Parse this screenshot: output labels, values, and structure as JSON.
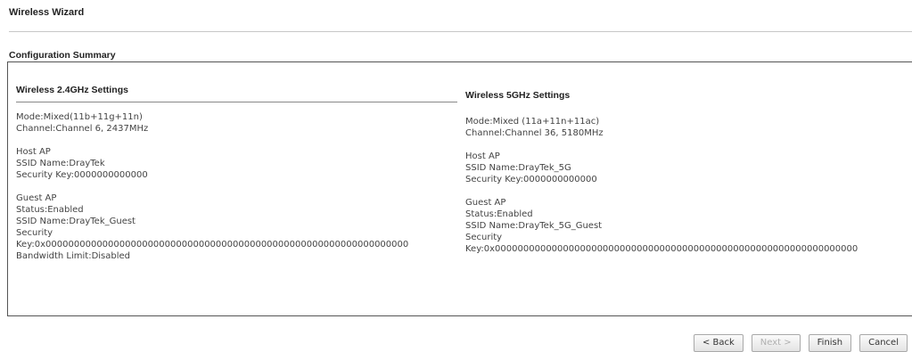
{
  "page": {
    "title": "Wireless Wizard"
  },
  "summary": {
    "title": "Configuration Summary"
  },
  "wireless_24": {
    "title": "Wireless 2.4GHz Settings",
    "mode": "Mode:Mixed(11b+11g+11n)",
    "channel": "Channel:Channel 6, 2437MHz",
    "host_ap": {
      "label": "Host AP",
      "ssid": "SSID Name:DrayTek",
      "security_key": "Security Key:0000000000000"
    },
    "guest_ap": {
      "label": "Guest AP",
      "status": "Status:Enabled",
      "ssid": "SSID Name:DrayTek_Guest",
      "security_label": "Security",
      "security_key": "Key:0x0000000000000000000000000000000000000000000000000000000000000000",
      "bandwidth": "Bandwidth Limit:Disabled"
    }
  },
  "wireless_5g": {
    "title": "Wireless 5GHz Settings",
    "mode": "Mode:Mixed (11a+11n+11ac)",
    "channel": "Channel:Channel 36, 5180MHz",
    "host_ap": {
      "label": "Host AP",
      "ssid": "SSID Name:DrayTek_5G",
      "security_key": "Security Key:0000000000000"
    },
    "guest_ap": {
      "label": "Guest AP",
      "status": "Status:Enabled",
      "ssid": "SSID Name:DrayTek_5G_Guest",
      "security_label": "Security",
      "security_key": "Key:0x0000000000000000000000000000000000000000000000000000000000000000"
    }
  },
  "buttons": {
    "back": "< Back",
    "next": "Next >",
    "finish": "Finish",
    "cancel": "Cancel"
  }
}
